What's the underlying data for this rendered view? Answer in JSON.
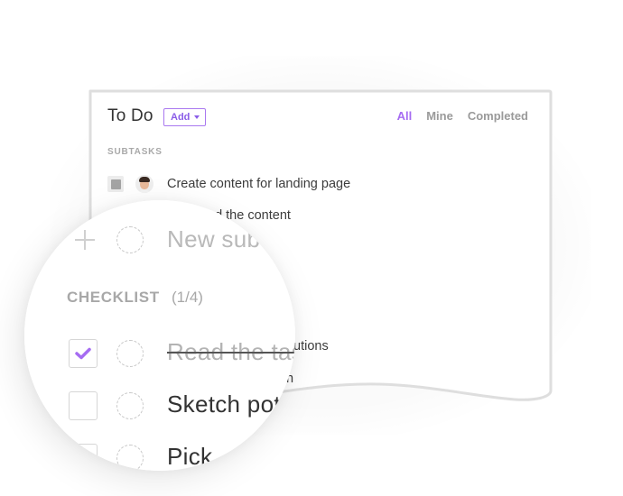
{
  "card": {
    "title": "To Do",
    "add_button": {
      "label": "Add"
    },
    "filters": [
      {
        "label": "All",
        "active": true
      },
      {
        "label": "Mine",
        "active": false
      },
      {
        "label": "Completed",
        "active": false
      }
    ],
    "subtasks_label": "SUBTASKS",
    "subtasks": [
      {
        "text": "Create content for landing page",
        "status": "todo",
        "has_avatar": true
      }
    ],
    "partial_texts": {
      "subtask_2_visible": "nd the content",
      "checklist_1_visible": "utions",
      "checklist_2_visible": "n"
    }
  },
  "magnifier": {
    "new_subtask_placeholder": "New sub",
    "checklist_label": "CHECKLIST",
    "checklist_count": "(1/4)",
    "checklist_items": [
      {
        "text": "Read the tas",
        "checked": true
      },
      {
        "text": "Sketch pot",
        "checked": false
      },
      {
        "text": "Pick",
        "checked": false
      }
    ]
  },
  "colors": {
    "accent": "#a66cf2",
    "accent_dark": "#8a5de8",
    "border": "#e1e1e1",
    "muted_text": "#a9a9a9",
    "body_text": "#3c3c3c"
  }
}
